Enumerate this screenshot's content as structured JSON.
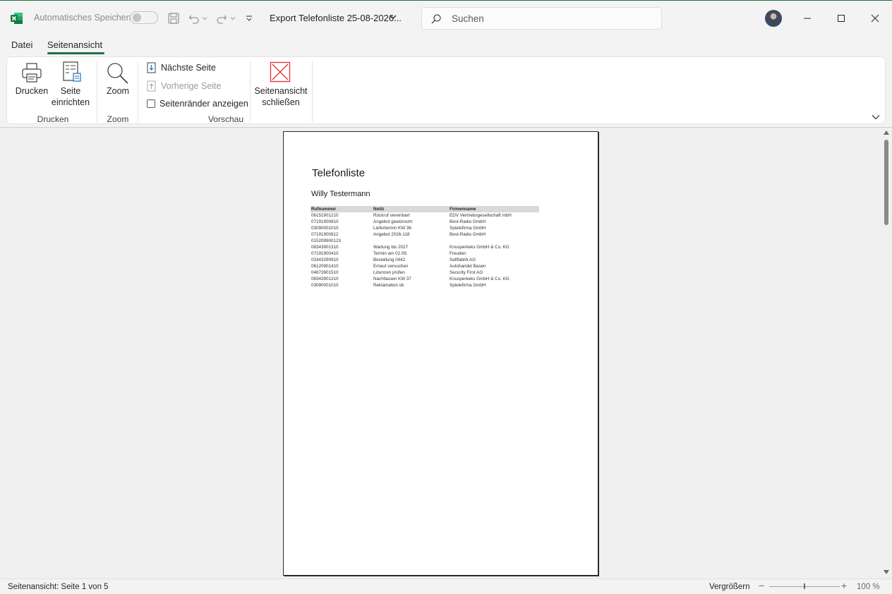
{
  "titlebar": {
    "autosave_label": "Automatisches Speichern",
    "document_title": "Export Telefonliste 25-08-2026...",
    "search_placeholder": "Suchen"
  },
  "tabs": [
    {
      "label": "Datei",
      "active": false
    },
    {
      "label": "Seitenansicht",
      "active": true
    }
  ],
  "ribbon": {
    "groups": {
      "print": {
        "label": "Drucken",
        "print_button": "Drucken",
        "page_setup_line1": "Seite",
        "page_setup_line2": "einrichten"
      },
      "zoom": {
        "label": "Zoom",
        "zoom_button": "Zoom"
      },
      "preview": {
        "label": "Vorschau",
        "next_page": "Nächste Seite",
        "prev_page": "Vorherige Seite",
        "show_margins": "Seitenränder anzeigen",
        "show_margins_checked": false,
        "close_line1": "Seitenansicht",
        "close_line2": "schließen"
      }
    }
  },
  "page": {
    "title": "Telefonliste",
    "subtitle": "Willy Testermann",
    "table": {
      "headers": [
        "Rufnummer",
        "Notiz",
        "Firmenname"
      ],
      "rows": [
        [
          "06151901210",
          "Rückruf vereinbart",
          "EDV Vertriebsgesellschaft mbH"
        ],
        [
          "07191900810",
          "Angebot gewünscht",
          "Best-Radio GmbH"
        ],
        [
          "03090001010",
          "Liefertermin KW 36",
          "Spielefirma GmbH"
        ],
        [
          "07191900812",
          "Angebot 2026-118",
          "Best-Radio GmbH"
        ],
        [
          "015209900123",
          "",
          ""
        ],
        [
          "08343901310",
          "Wartung bis 2027",
          "Knusperkeks GmbH & Co. KG"
        ],
        [
          "07191900410",
          "Termin am 02.09.",
          "Freuden"
        ],
        [
          "03343290910",
          "Bestellung 0442",
          "Saftfabrik AG"
        ],
        [
          "06120901410",
          "Erneut versuchen",
          "Autohandel Basen"
        ],
        [
          "04873901510",
          "Lizenzen prüfen",
          "Security First AG"
        ],
        [
          "08343901310",
          "Nachfassen KW 37",
          "Knusperkeks GmbH & Co. KG"
        ],
        [
          "03090001010",
          "Reklamation ok",
          "Spielefirma GmbH"
        ]
      ]
    }
  },
  "statusbar": {
    "status": "Seitenansicht: Seite 1 von 5",
    "zoom_label": "Vergrößern",
    "zoom_minus": "−",
    "zoom_plus": "+",
    "zoom_value": "100 %",
    "zoom_percent": 100
  },
  "colors": {
    "accent": "#1e7145",
    "close_icon": "#e03030"
  }
}
